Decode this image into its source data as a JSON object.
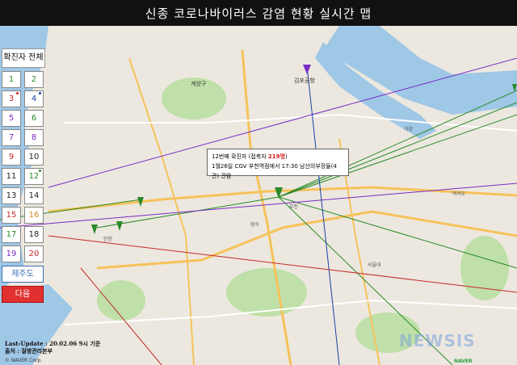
{
  "header": {
    "title": "신종 코로나바이러스 감염 현황 실시간 맵"
  },
  "sidebar": {
    "all_label": "확진자 전체",
    "cases": [
      {
        "label": "1",
        "color": "green"
      },
      {
        "label": "2",
        "color": "green"
      },
      {
        "label": "3",
        "color": "red",
        "marked": true
      },
      {
        "label": "4",
        "color": "blue",
        "marked": true
      },
      {
        "label": "5",
        "color": "purple"
      },
      {
        "label": "6",
        "color": "green"
      },
      {
        "label": "7",
        "color": "purple"
      },
      {
        "label": "8",
        "color": "purple"
      },
      {
        "label": "9",
        "color": "red"
      },
      {
        "label": "10",
        "color": "dark"
      },
      {
        "label": "11",
        "color": "dark"
      },
      {
        "label": "12",
        "color": "green",
        "marked": true
      },
      {
        "label": "13",
        "color": "dark"
      },
      {
        "label": "14",
        "color": "dark"
      },
      {
        "label": "15",
        "color": "red"
      },
      {
        "label": "16",
        "color": "orange"
      },
      {
        "label": "17",
        "color": "green"
      },
      {
        "label": "18",
        "color": "dark"
      },
      {
        "label": "19",
        "color": "purple"
      },
      {
        "label": "20",
        "color": "red"
      }
    ],
    "jeju_label": "제주도",
    "next_label": "다음"
  },
  "popup": {
    "case_label": "12번째 확진자",
    "contacts_prefix": "(접촉자",
    "contacts_count": "219명",
    "contacts_suffix": ")",
    "detail": "1월26일 CGV 부천역점에서 17:30 남산의부장들(4관) 관람"
  },
  "footer": {
    "last_update": "Last-Update : 20.02.06 9시 기준",
    "source": "출처 : 질병관리본부",
    "copyright": "© NAVER Corp.",
    "watermark": "NEWSIS",
    "naver": "NAVER"
  },
  "map_labels": {
    "gyeyang": "계양구",
    "gimpo_airport": "김포공항",
    "gayang": "가양",
    "bucheon": "부천",
    "incheon": "인천",
    "jangsu": "장수",
    "seoul_univ": "서울대",
    "yeouido": "여의도"
  },
  "colors": {
    "green": "#2a8a2a",
    "red": "#c62828",
    "purple": "#7a2ac6",
    "blue": "#1a3fa8",
    "orange": "#d08a20",
    "dark": "#222222",
    "water": "#9fc7e6",
    "park": "#bfe0a8",
    "road": "#f6c25a"
  }
}
